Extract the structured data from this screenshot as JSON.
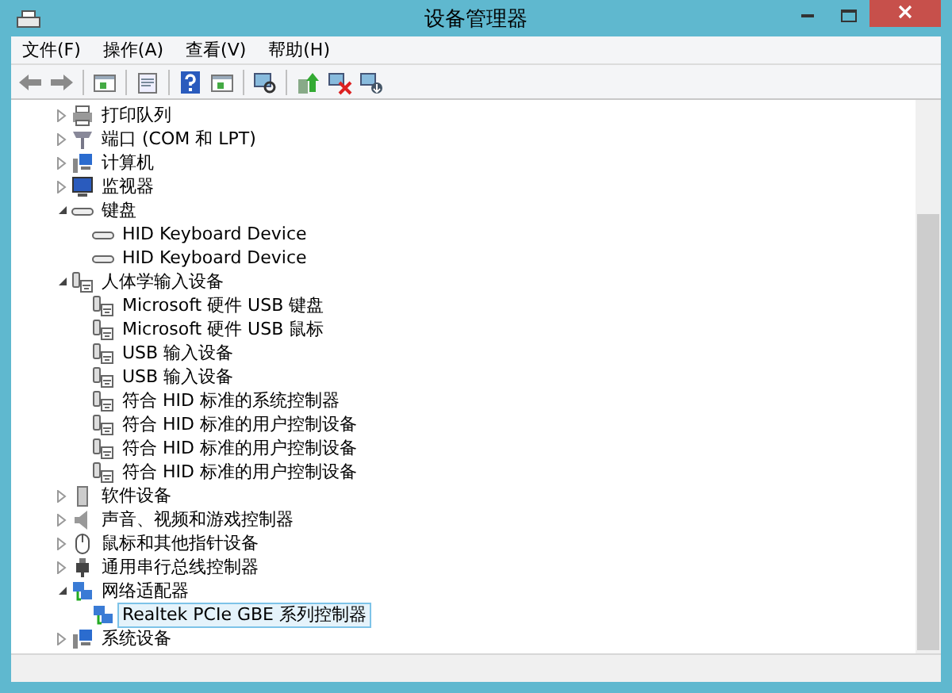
{
  "window": {
    "title": "设备管理器"
  },
  "menu": [
    "文件(F)",
    "操作(A)",
    "查看(V)",
    "帮助(H)"
  ],
  "toolbar": [
    {
      "kind": "back"
    },
    {
      "kind": "forward"
    },
    {
      "kind": "sep"
    },
    {
      "kind": "pane"
    },
    {
      "kind": "sep"
    },
    {
      "kind": "properties"
    },
    {
      "kind": "sep"
    },
    {
      "kind": "help"
    },
    {
      "kind": "pane"
    },
    {
      "kind": "sep"
    },
    {
      "kind": "scan"
    },
    {
      "kind": "sep"
    },
    {
      "kind": "update"
    },
    {
      "kind": "disable"
    },
    {
      "kind": "uninstall"
    }
  ],
  "tree": [
    {
      "label": "打印队列",
      "kind": "printer",
      "expanded": false
    },
    {
      "label": "端口 (COM 和 LPT)",
      "kind": "port",
      "expanded": false
    },
    {
      "label": "计算机",
      "kind": "computer",
      "expanded": false
    },
    {
      "label": "监视器",
      "kind": "monitor",
      "expanded": false
    },
    {
      "label": "键盘",
      "kind": "keyboard",
      "expanded": true,
      "children": [
        {
          "label": "HID Keyboard Device",
          "kind": "keyboard",
          "selected": false
        },
        {
          "label": "HID Keyboard Device",
          "kind": "keyboard",
          "selected": false
        }
      ]
    },
    {
      "label": "人体学输入设备",
      "kind": "hid",
      "expanded": true,
      "children": [
        {
          "label": "Microsoft 硬件 USB 键盘",
          "kind": "hid",
          "selected": false
        },
        {
          "label": "Microsoft 硬件 USB 鼠标",
          "kind": "hid",
          "selected": false
        },
        {
          "label": "USB 输入设备",
          "kind": "hid",
          "selected": false
        },
        {
          "label": "USB 输入设备",
          "kind": "hid",
          "selected": false
        },
        {
          "label": "符合 HID 标准的系统控制器",
          "kind": "hid",
          "selected": false
        },
        {
          "label": "符合 HID 标准的用户控制设备",
          "kind": "hid",
          "selected": false
        },
        {
          "label": "符合 HID 标准的用户控制设备",
          "kind": "hid",
          "selected": false
        },
        {
          "label": "符合 HID 标准的用户控制设备",
          "kind": "hid",
          "selected": false
        }
      ]
    },
    {
      "label": "软件设备",
      "kind": "software",
      "expanded": false
    },
    {
      "label": "声音、视频和游戏控制器",
      "kind": "sound",
      "expanded": false
    },
    {
      "label": "鼠标和其他指针设备",
      "kind": "mouse",
      "expanded": false
    },
    {
      "label": "通用串行总线控制器",
      "kind": "usb",
      "expanded": false
    },
    {
      "label": "网络适配器",
      "kind": "network",
      "expanded": true,
      "children": [
        {
          "label": "Realtek PCIe GBE 系列控制器",
          "kind": "network",
          "selected": true
        }
      ]
    },
    {
      "label": "系统设备",
      "kind": "computer",
      "expanded": false
    }
  ]
}
